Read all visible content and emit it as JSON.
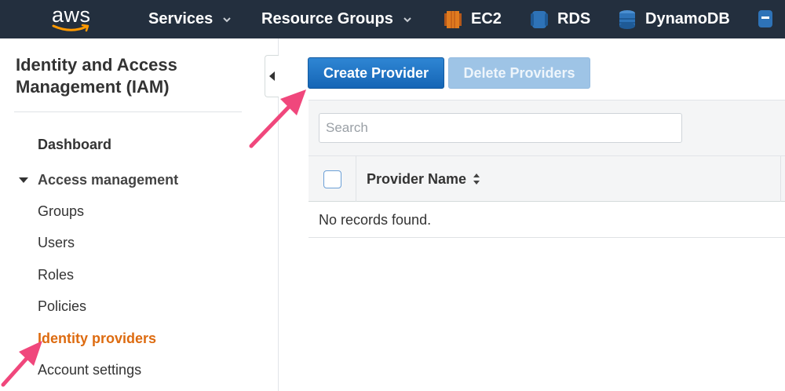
{
  "topbar": {
    "logo_text": "aws",
    "nav": [
      {
        "label": "Services"
      },
      {
        "label": "Resource Groups"
      }
    ],
    "services": [
      {
        "label": "EC2",
        "icon": "ec2-icon"
      },
      {
        "label": "RDS",
        "icon": "rds-icon"
      },
      {
        "label": "DynamoDB",
        "icon": "dynamodb-icon"
      }
    ]
  },
  "sidebar": {
    "title": "Identity and Access Management (IAM)",
    "dashboard": "Dashboard",
    "section": "Access management",
    "items": [
      {
        "label": "Groups"
      },
      {
        "label": "Users"
      },
      {
        "label": "Roles"
      },
      {
        "label": "Policies"
      },
      {
        "label": "Identity providers",
        "active": true
      },
      {
        "label": "Account settings"
      }
    ]
  },
  "toolbar": {
    "create_label": "Create Provider",
    "delete_label": "Delete Providers"
  },
  "search": {
    "placeholder": "Search",
    "value": ""
  },
  "table": {
    "columns": [
      "Provider Name"
    ],
    "empty_text": "No records found."
  },
  "colors": {
    "topbar": "#232f3e",
    "primary": "#1a6fc2",
    "active_link": "#dd6b10",
    "annotation_arrow": "#f0477c"
  }
}
